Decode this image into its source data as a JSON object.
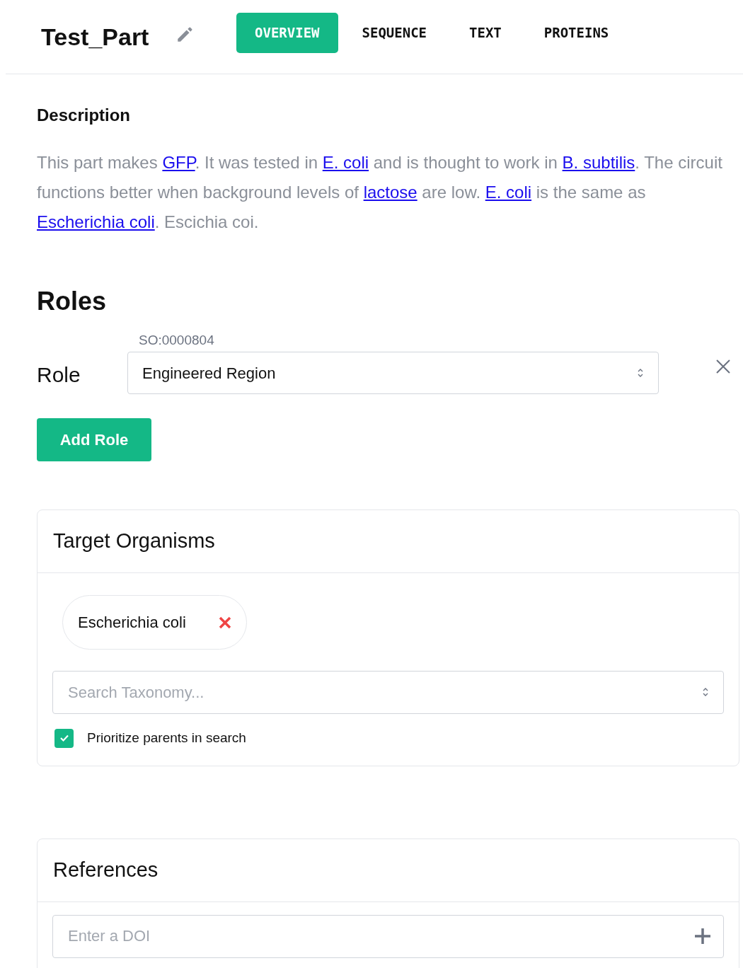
{
  "header": {
    "title": "Test_Part",
    "tabs": [
      {
        "label": "OVERVIEW",
        "selected": true
      },
      {
        "label": "SEQUENCE",
        "selected": false
      },
      {
        "label": "TEXT",
        "selected": false
      },
      {
        "label": "PROTEINS",
        "selected": false
      }
    ]
  },
  "description": {
    "heading": "Description",
    "segments": [
      {
        "kind": "plain",
        "text": "This part makes "
      },
      {
        "kind": "link",
        "text": "GFP"
      },
      {
        "kind": "plain",
        "text": ". It was tested in "
      },
      {
        "kind": "link",
        "text": "E. coli"
      },
      {
        "kind": "plain",
        "text": " and is thought to work in "
      },
      {
        "kind": "link",
        "text": "B. subtilis"
      },
      {
        "kind": "plain",
        "text": ". The circuit functions better when background levels of "
      },
      {
        "kind": "link",
        "text": "lactose"
      },
      {
        "kind": "plain",
        "text": " are low. "
      },
      {
        "kind": "link",
        "text": "E. coli"
      },
      {
        "kind": "plain",
        "text": " is the same as "
      },
      {
        "kind": "link",
        "text": "Escherichia coli"
      },
      {
        "kind": "plain",
        "text": ". Escichia coi."
      }
    ]
  },
  "roles": {
    "heading": "Roles",
    "items": [
      {
        "label": "Role",
        "code": "SO:0000804",
        "value": "Engineered Region"
      }
    ],
    "add_button": "Add Role"
  },
  "target_organisms": {
    "heading": "Target Organisms",
    "tags": [
      "Escherichia coli"
    ],
    "search": {
      "placeholder": "Search Taxonomy..."
    },
    "checkbox": {
      "label": "Prioritize parents in search",
      "checked": true
    }
  },
  "references": {
    "heading": "References",
    "input": {
      "placeholder": "Enter a DOI"
    }
  }
}
